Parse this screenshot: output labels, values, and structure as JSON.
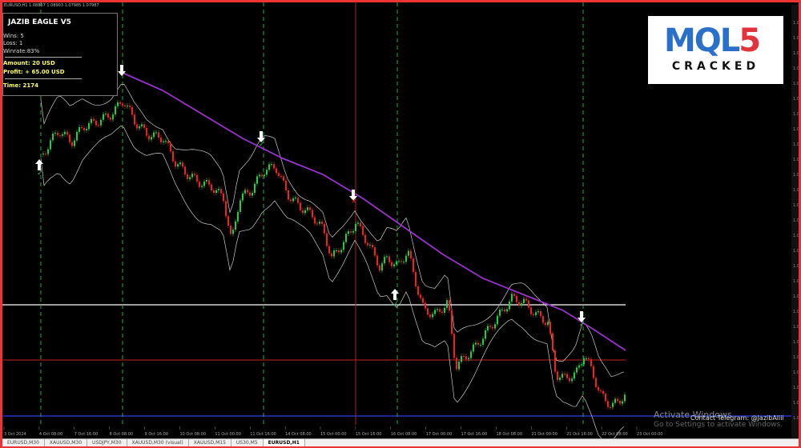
{
  "header": {
    "title": "EURUSD,H1  1.08867 1.08903 1.07985 1.07987"
  },
  "panel": {
    "title": "JAZIB EAGLE V5",
    "wins": "Wins: 5",
    "loss": "Loss: 1",
    "winrate": "Winrate:83%",
    "amount": "Amount: 20 USD",
    "profit": "Profit: + 65.00 USD",
    "time": "Time:  2174"
  },
  "logo": {
    "mark_blue": "MQL",
    "mark_red": "5",
    "sub": "CRACKED"
  },
  "watermark": {
    "line1": "Activate Windows",
    "line2": "Go to Settings to activate Windows."
  },
  "telegram": "Contact Telegram: @JazibAliii",
  "date_labels": [
    "3 Oct 2024",
    "4 Oct 08:00",
    "7 Oct 16:00",
    "8 Oct 08:00",
    "9 Oct 16:00",
    "10 Oct 08:00",
    "11 Oct 00:00",
    "11 Oct 16:00",
    "14 Oct 08:00",
    "15 Oct 00:00",
    "15 Oct 16:00",
    "16 Oct 08:00",
    "17 Oct 00:00",
    "17 Oct 16:00",
    "18 Oct 08:00",
    "21 Oct 00:00",
    "21 Oct 16:00",
    "22 Oct 08:00",
    "23 Oct 00:00"
  ],
  "tabs": [
    "EURUSD,M30",
    "XAUUSD,M30",
    "USDJPY,M30",
    "XAUUSD,M30 (visual)",
    "XAUUSD,M15",
    "US30,M5",
    "EURUSD,H1"
  ],
  "active_tab": "EURUSD,H1",
  "price_labels": [
    "1.0",
    "1.0",
    "1.0",
    "1.0",
    "1.0",
    "1.0",
    "1.0",
    "1.0",
    "1.0",
    "1.0",
    "1.0",
    "1.0",
    "1.0",
    "1.0",
    "1.0",
    "1.0",
    "1.0",
    "1.0",
    "1.0",
    "1.0",
    "1.0",
    "1.0",
    "1.0",
    "1.0",
    "1.0",
    "1.0",
    "1.0"
  ],
  "colors": {
    "bull": "#22cc44",
    "bear": "#ee2222",
    "ma": "#9933cc",
    "band": "#cccccc",
    "vline": "#22aa44",
    "vline_red": "#aa2222",
    "hline_white": "#ffffff",
    "hline_red": "#cc2222",
    "hline_blue": "#2233cc"
  }
}
